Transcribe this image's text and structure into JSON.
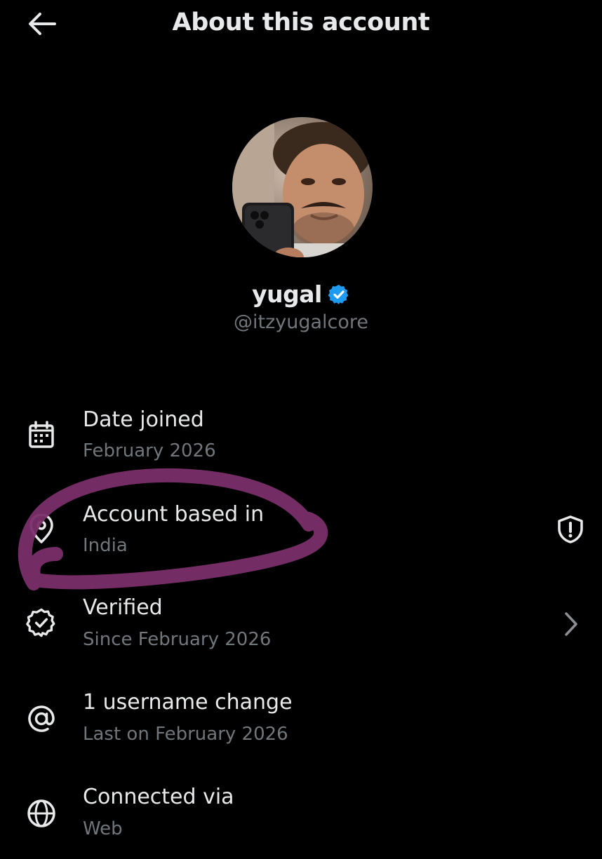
{
  "header": {
    "title": "About this account",
    "back_icon": "arrow-left-icon"
  },
  "profile": {
    "display_name": "yugal",
    "handle": "@itzyugalcore",
    "verified_badge_color": "#1d9bf0",
    "avatar_description_icon": "profile-photo"
  },
  "rows": [
    {
      "icon": "calendar-icon",
      "title": "Date joined",
      "subtitle": "February 2026"
    },
    {
      "icon": "location-pin-icon",
      "title": "Account based in",
      "subtitle": "India",
      "trailing_icon": "shield-alert-icon"
    },
    {
      "icon": "verified-badge-icon",
      "title": "Verified",
      "subtitle": "Since February 2026",
      "trailing_icon": "chevron-right-icon"
    },
    {
      "icon": "at-sign-icon",
      "title": "1 username change",
      "subtitle": "Last on February 2026"
    },
    {
      "icon": "globe-icon",
      "title": "Connected via",
      "subtitle": "Web"
    }
  ],
  "colors": {
    "background": "#000000",
    "primary_text": "#e7e9ea",
    "secondary_text": "#71767b",
    "annotation_stroke": "#7a2f69"
  }
}
